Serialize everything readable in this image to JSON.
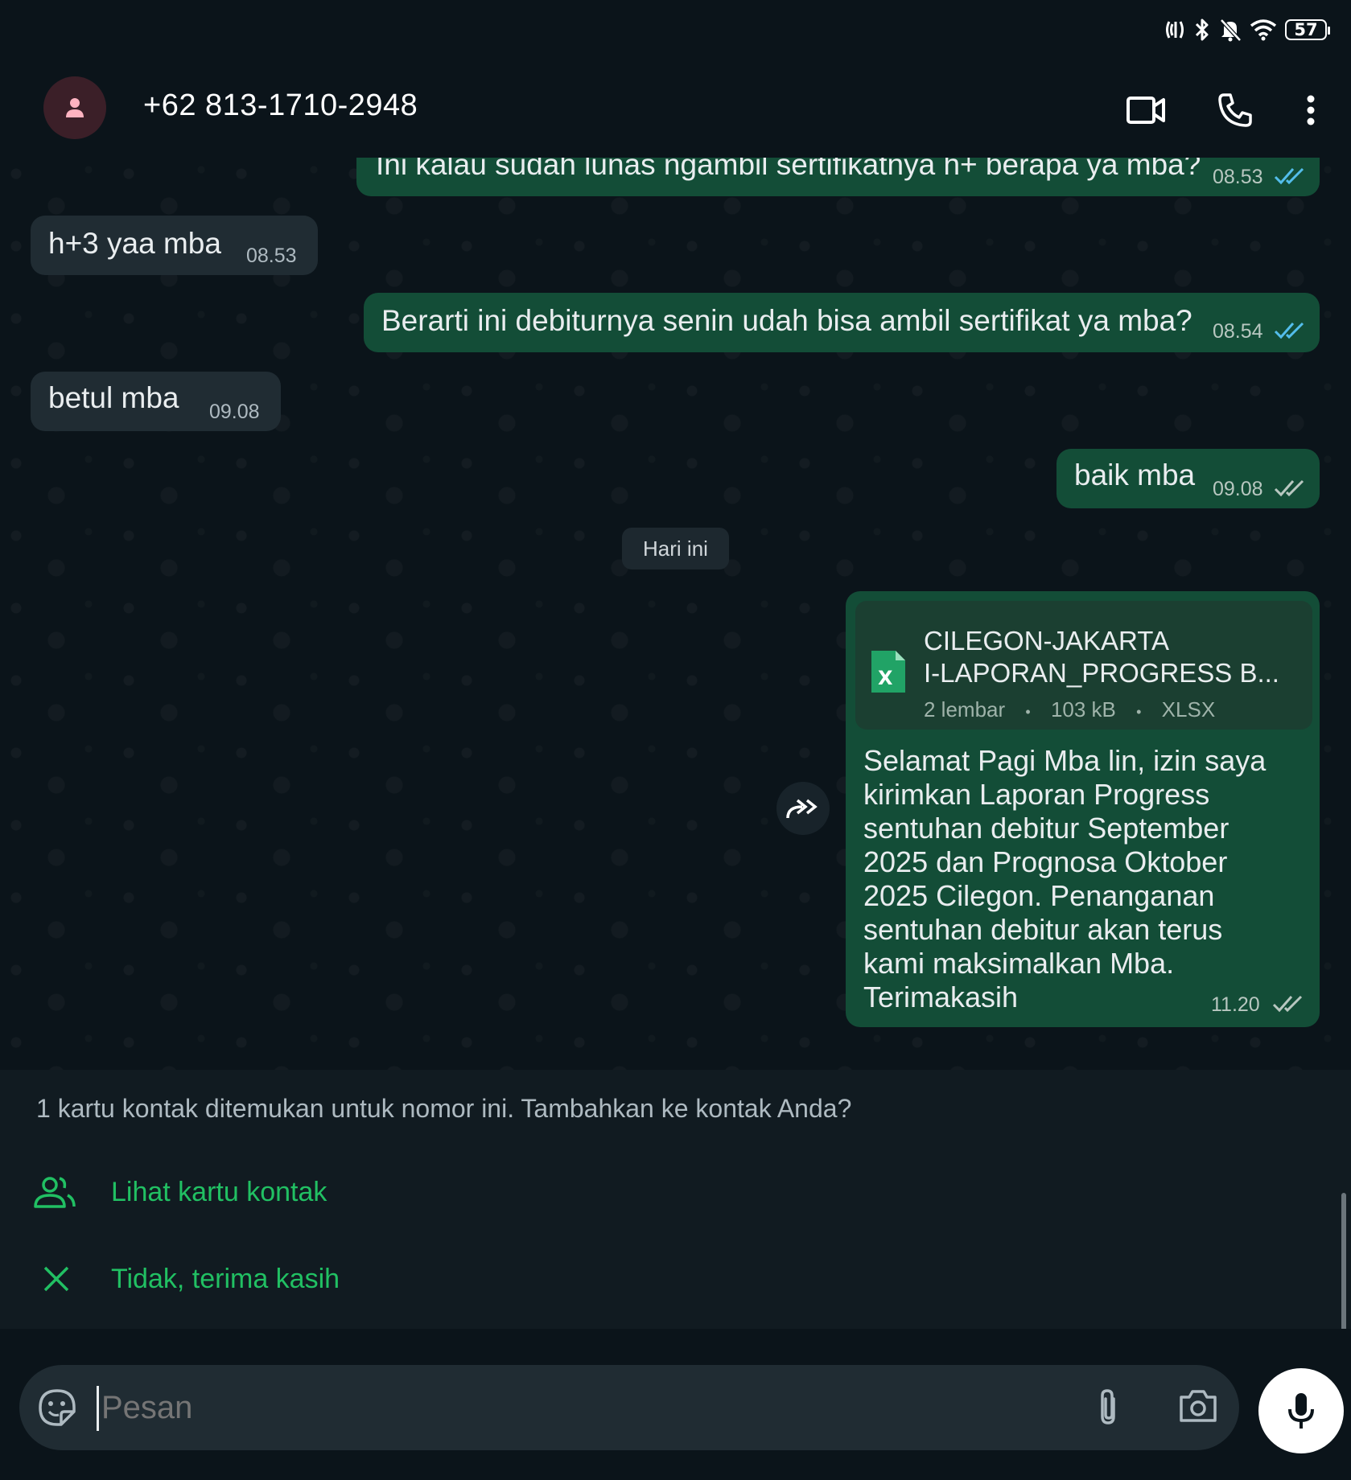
{
  "status_bar": {
    "battery_level": "57"
  },
  "header": {
    "contact_name": "+62 813-1710-2948"
  },
  "messages": [
    {
      "text": "Ini kalau sudah lunas ngambil sertifikatnya h+ berapa ya mba?",
      "time": "08.53"
    },
    {
      "text": "h+3 yaa mba",
      "time": "08.53"
    },
    {
      "text": "Berarti ini debiturnya senin udah bisa ambil sertifikat ya mba?",
      "time": "08.54"
    },
    {
      "text": "betul mba",
      "time": "09.08"
    },
    {
      "text": "baik mba",
      "time": "09.08"
    }
  ],
  "day_separator": "Hari ini",
  "document_message": {
    "file_name_line1": "CILEGON-JAKARTA",
    "file_name_line2": "I-LAPORAN_PROGRESS B...",
    "icon_letter": "X",
    "pages": "2 lembar",
    "size": "103 kB",
    "type": "XLSX",
    "separator": "•",
    "caption_lines": [
      "Selamat Pagi Mba lin, izin saya",
      "kirimkan Laporan Progress",
      "sentuhan debitur September",
      "2025 dan Prognosa Oktober",
      "2025 Cilegon. Penanganan",
      "sentuhan debitur akan terus",
      "kami maksimalkan Mba.",
      "Terimakasih"
    ],
    "time": "11.20"
  },
  "contact_prompt": {
    "message": "1 kartu kontak ditemukan untuk nomor ini. Tambahkan ke kontak Anda?",
    "view_label": "Lihat kartu kontak",
    "dismiss_label": "Tidak, terima kasih"
  },
  "composer": {
    "placeholder": "Pesan"
  },
  "colors": {
    "outgoing_bubble": "#134d37",
    "incoming_bubble": "#202c33",
    "accent_green": "#21c063",
    "read_tick_blue": "#53bdeb"
  },
  "icons": [
    "nfc-icon",
    "bluetooth-icon",
    "mute-icon",
    "wifi-icon",
    "battery-icon",
    "avatar-person-icon",
    "video-call-icon",
    "phone-icon",
    "more-options-icon",
    "excel-file-icon",
    "forward-icon",
    "contacts-icon",
    "close-icon",
    "sticker-icon",
    "attach-icon",
    "camera-icon",
    "mic-icon"
  ]
}
